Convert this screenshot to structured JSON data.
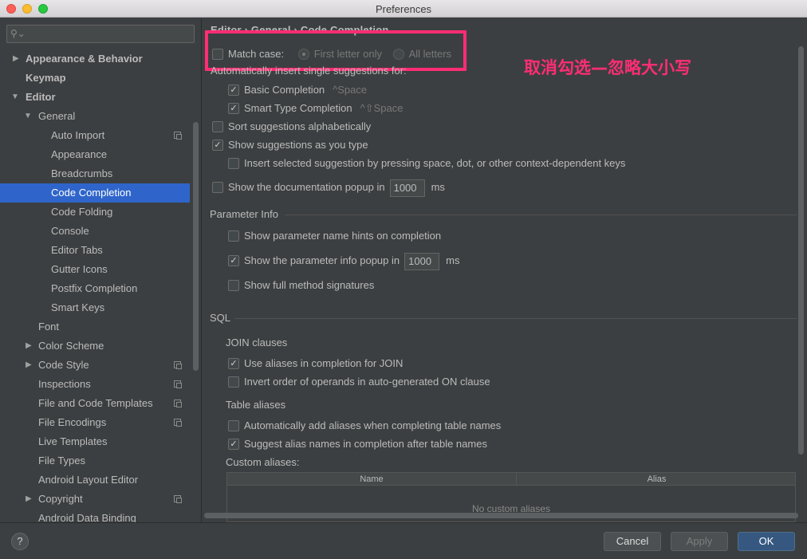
{
  "window": {
    "title": "Preferences"
  },
  "search": {
    "placeholder": ""
  },
  "sidebar": {
    "items": [
      {
        "label": "Appearance & Behavior",
        "arrow": "▶"
      },
      {
        "label": "Keymap"
      },
      {
        "label": "Editor",
        "arrow": "▼"
      },
      {
        "label": "General",
        "arrow": "▼"
      },
      {
        "label": "Auto Import"
      },
      {
        "label": "Appearance"
      },
      {
        "label": "Breadcrumbs"
      },
      {
        "label": "Code Completion"
      },
      {
        "label": "Code Folding"
      },
      {
        "label": "Console"
      },
      {
        "label": "Editor Tabs"
      },
      {
        "label": "Gutter Icons"
      },
      {
        "label": "Postfix Completion"
      },
      {
        "label": "Smart Keys"
      },
      {
        "label": "Font"
      },
      {
        "label": "Color Scheme",
        "arrow": "▶"
      },
      {
        "label": "Code Style",
        "arrow": "▶"
      },
      {
        "label": "Inspections"
      },
      {
        "label": "File and Code Templates"
      },
      {
        "label": "File Encodings"
      },
      {
        "label": "Live Templates"
      },
      {
        "label": "File Types"
      },
      {
        "label": "Android Layout Editor"
      },
      {
        "label": "Copyright",
        "arrow": "▶"
      },
      {
        "label": "Android Data Binding"
      }
    ]
  },
  "breadcrumb": {
    "text": "Editor  ›  General  ›  Code Completion"
  },
  "options": {
    "match_case": "Match case:",
    "first_letter_only": "First letter only",
    "all_letters": "All letters",
    "auto_insert": "Automatically insert single suggestions for:",
    "basic_completion": "Basic Completion",
    "basic_shortcut": "^Space",
    "smart_type": "Smart Type Completion",
    "smart_shortcut": "^⇧Space",
    "sort_alpha": "Sort suggestions alphabetically",
    "show_as_type": "Show suggestions as you type",
    "insert_selected": "Insert selected suggestion by pressing space, dot, or other context-dependent keys",
    "doc_popup": "Show the documentation popup in",
    "doc_popup_ms": "1000",
    "ms": "ms"
  },
  "param_info": {
    "title": "Parameter Info",
    "name_hints": "Show parameter name hints on completion",
    "info_popup": "Show the parameter info popup in",
    "info_popup_ms": "1000",
    "ms": "ms",
    "full_signatures": "Show full method signatures"
  },
  "sql": {
    "title": "SQL",
    "join_title": "JOIN clauses",
    "use_aliases": "Use aliases in completion for JOIN",
    "invert_order": "Invert order of operands in auto-generated ON clause",
    "table_aliases_title": "Table aliases",
    "auto_add": "Automatically add aliases when completing table names",
    "suggest_alias": "Suggest alias names in completion after table names",
    "custom_aliases": "Custom aliases:",
    "col_name": "Name",
    "col_alias": "Alias",
    "empty": "No custom aliases"
  },
  "annotation": {
    "note": "取消勾选—忽略大小写"
  },
  "footer": {
    "help": "?",
    "cancel": "Cancel",
    "apply": "Apply",
    "ok": "OK"
  },
  "colors": {
    "selection": "#2f65ca",
    "annotation": "#ff2d73",
    "ok_button": "#365880"
  }
}
